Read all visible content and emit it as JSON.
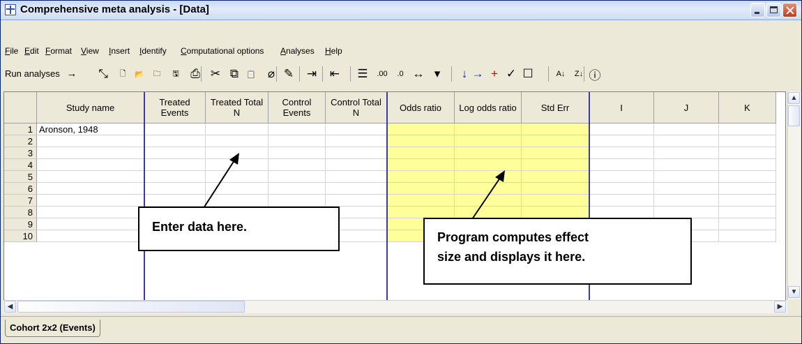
{
  "window": {
    "title": "Comprehensive meta analysis - [Data]",
    "title_icon": "spreadsheet-icon",
    "controls": [
      "minimize-icon",
      "maximize-icon",
      "close-icon"
    ]
  },
  "menu": {
    "items": [
      "File",
      "Edit",
      "Format",
      "View",
      "Insert",
      "Identify",
      "Computational options",
      "Analyses",
      "Help"
    ]
  },
  "toolbar": {
    "run_label": "Run analyses",
    "run_arrow": "→",
    "icons": [
      {
        "name": "pointer-icon",
        "glyph": "⤡"
      },
      {
        "name": "new-icon",
        "glyph": "🗋"
      },
      {
        "name": "open-icon",
        "glyph": "📂"
      },
      {
        "name": "open-file-icon",
        "glyph": "🗀"
      },
      {
        "name": "save-icon",
        "glyph": "🖫"
      },
      {
        "name": "print-icon",
        "glyph": "⎙"
      },
      {
        "name": "cut-icon",
        "glyph": "✂"
      },
      {
        "name": "copy-icon",
        "glyph": "⧉"
      },
      {
        "name": "paste-icon",
        "glyph": "📋"
      },
      {
        "name": "eraser-icon",
        "glyph": "⌀"
      },
      {
        "name": "edit-icon",
        "glyph": "✎"
      },
      {
        "name": "indent-icon",
        "glyph": "⇥"
      },
      {
        "name": "outdent-icon",
        "glyph": "⇤"
      },
      {
        "name": "list-icon",
        "glyph": "☰"
      },
      {
        "name": "decrease-decimal-icon",
        "glyph": ".00"
      },
      {
        "name": "increase-decimal-icon",
        "glyph": ".0"
      },
      {
        "name": "column-width-icon",
        "glyph": "↔"
      },
      {
        "name": "dropdown-icon",
        "glyph": "▾"
      },
      {
        "name": "move-down-icon",
        "glyph": "↓"
      },
      {
        "name": "move-right-icon",
        "glyph": "→"
      },
      {
        "name": "add-icon",
        "glyph": "+"
      },
      {
        "name": "check-icon",
        "glyph": "✓"
      },
      {
        "name": "checkbox-icon",
        "glyph": "☐"
      },
      {
        "name": "sort-ascending-icon",
        "glyph": "A↓"
      },
      {
        "name": "sort-descending-icon",
        "glyph": "Z↓"
      },
      {
        "name": "help-icon",
        "glyph": "ⓘ"
      }
    ]
  },
  "grid": {
    "columns": [
      {
        "label": "Study name",
        "highlight": false
      },
      {
        "label": "Treated Events",
        "highlight": false
      },
      {
        "label": "Treated Total N",
        "highlight": false
      },
      {
        "label": "Control Events",
        "highlight": false
      },
      {
        "label": "Control Total N",
        "highlight": false
      },
      {
        "label": "Odds ratio",
        "highlight": true
      },
      {
        "label": "Log odds ratio",
        "highlight": true
      },
      {
        "label": "Std Err",
        "highlight": true
      },
      {
        "label": "I",
        "highlight": false
      },
      {
        "label": "J",
        "highlight": false
      },
      {
        "label": "K",
        "highlight": false
      }
    ],
    "row_numbers": [
      "1",
      "2",
      "3",
      "4",
      "5",
      "6",
      "7",
      "8",
      "9",
      "10"
    ],
    "cells": {
      "1": {
        "Study name": "Aronson, 1948"
      }
    },
    "highlight_color": "#ffff99",
    "separator_color": "#3a3aa0"
  },
  "sheet_tabs": [
    "Cohort 2x2 (Events)"
  ],
  "annotations": {
    "enter_data": "Enter data here.",
    "computes": [
      "Program computes effect",
      "size and displays it here."
    ]
  }
}
